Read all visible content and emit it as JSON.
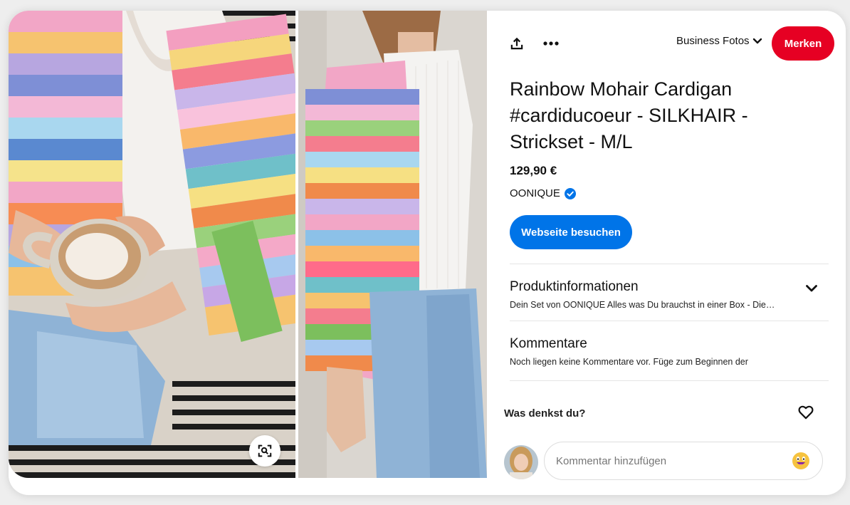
{
  "toolbar": {
    "share_icon": "share-upload-icon",
    "more_icon": "more-dots-icon",
    "board_name": "Business Fotos",
    "save_label": "Merken"
  },
  "pin": {
    "title": "Rainbow Mohair Cardigan #cardiducoeur - SILKHAIR - Strickset - M/L",
    "price": "129,90 €",
    "merchant": "OONIQUE",
    "verified_icon": "verified-check-icon",
    "visit_label": "Webseite besuchen"
  },
  "product_info": {
    "title": "Produktinformationen",
    "text": "Dein Set von OONIQUE Alles was Du brauchst in einer Box - Die…"
  },
  "comments": {
    "title": "Kommentare",
    "text": "Noch liegen keine Kommentare vor. Füge zum Beginnen der",
    "reaction_prompt": "Was denkst du?",
    "input_placeholder": "Kommentar hinzufügen"
  },
  "colors": {
    "save_red": "#e60023",
    "visit_blue": "#0074e8",
    "verified_blue": "#0074e8"
  }
}
